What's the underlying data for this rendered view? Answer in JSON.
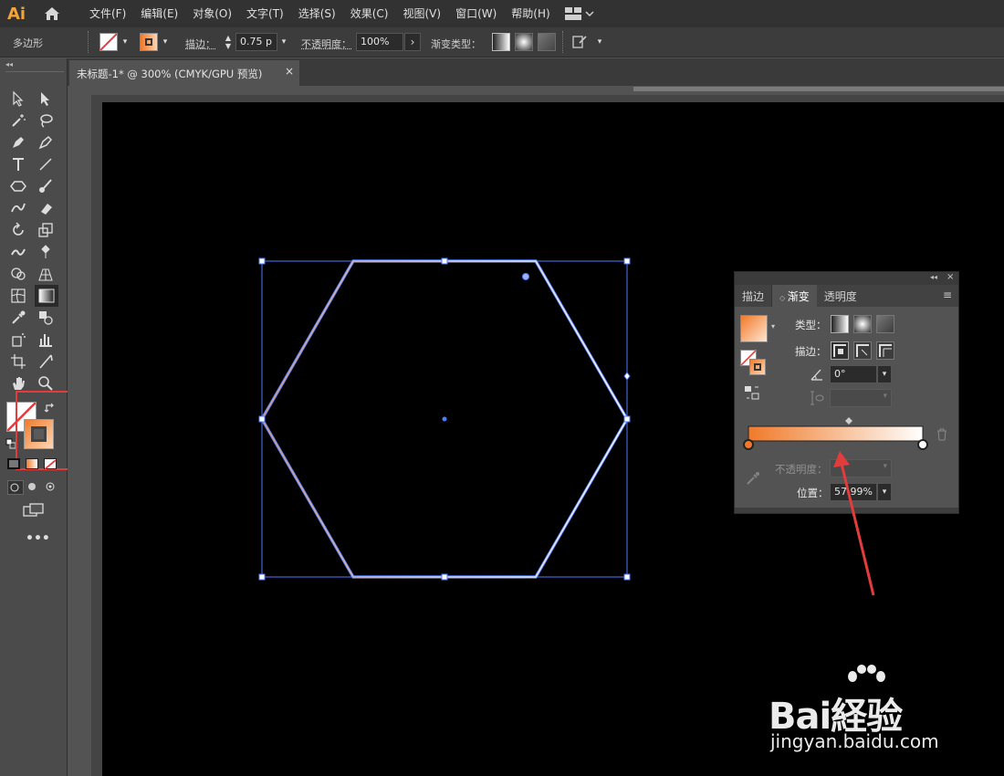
{
  "app": {
    "logo": "Ai",
    "icons": {
      "home": "home-icon",
      "workspace": "workspace-switcher-icon"
    }
  },
  "menu": [
    "文件(F)",
    "编辑(E)",
    "对象(O)",
    "文字(T)",
    "选择(S)",
    "效果(C)",
    "视图(V)",
    "窗口(W)",
    "帮助(H)"
  ],
  "control": {
    "selection_label": "多边形",
    "stroke_label": "描边：",
    "stroke_value": "0.75 p",
    "opacity_label": "不透明度：",
    "opacity_value": "100%",
    "opacity_arrow": "›",
    "gradient_type_label": "渐变类型："
  },
  "document_tab": {
    "title": "未标题-1* @ 300% (CMYK/GPU 预览)",
    "close": "×"
  },
  "colors": {
    "gradient_start": "#f07a2a",
    "gradient_end": "#ffffff",
    "selection": "#4c7bff",
    "highlight_red": "#e23c3c",
    "artboard": "#000000"
  },
  "gradient_panel": {
    "tabs": [
      "描边",
      "渐变",
      "透明度"
    ],
    "active_tab": "渐变",
    "type_label": "类型：",
    "stroke_label": "描边：",
    "angle_value": "0°",
    "opacity_label": "不透明度：",
    "position_label": "位置：",
    "position_value": "57.99%"
  },
  "watermark": {
    "brand": "Bai経验",
    "url": "jingyan.baidu.com"
  }
}
